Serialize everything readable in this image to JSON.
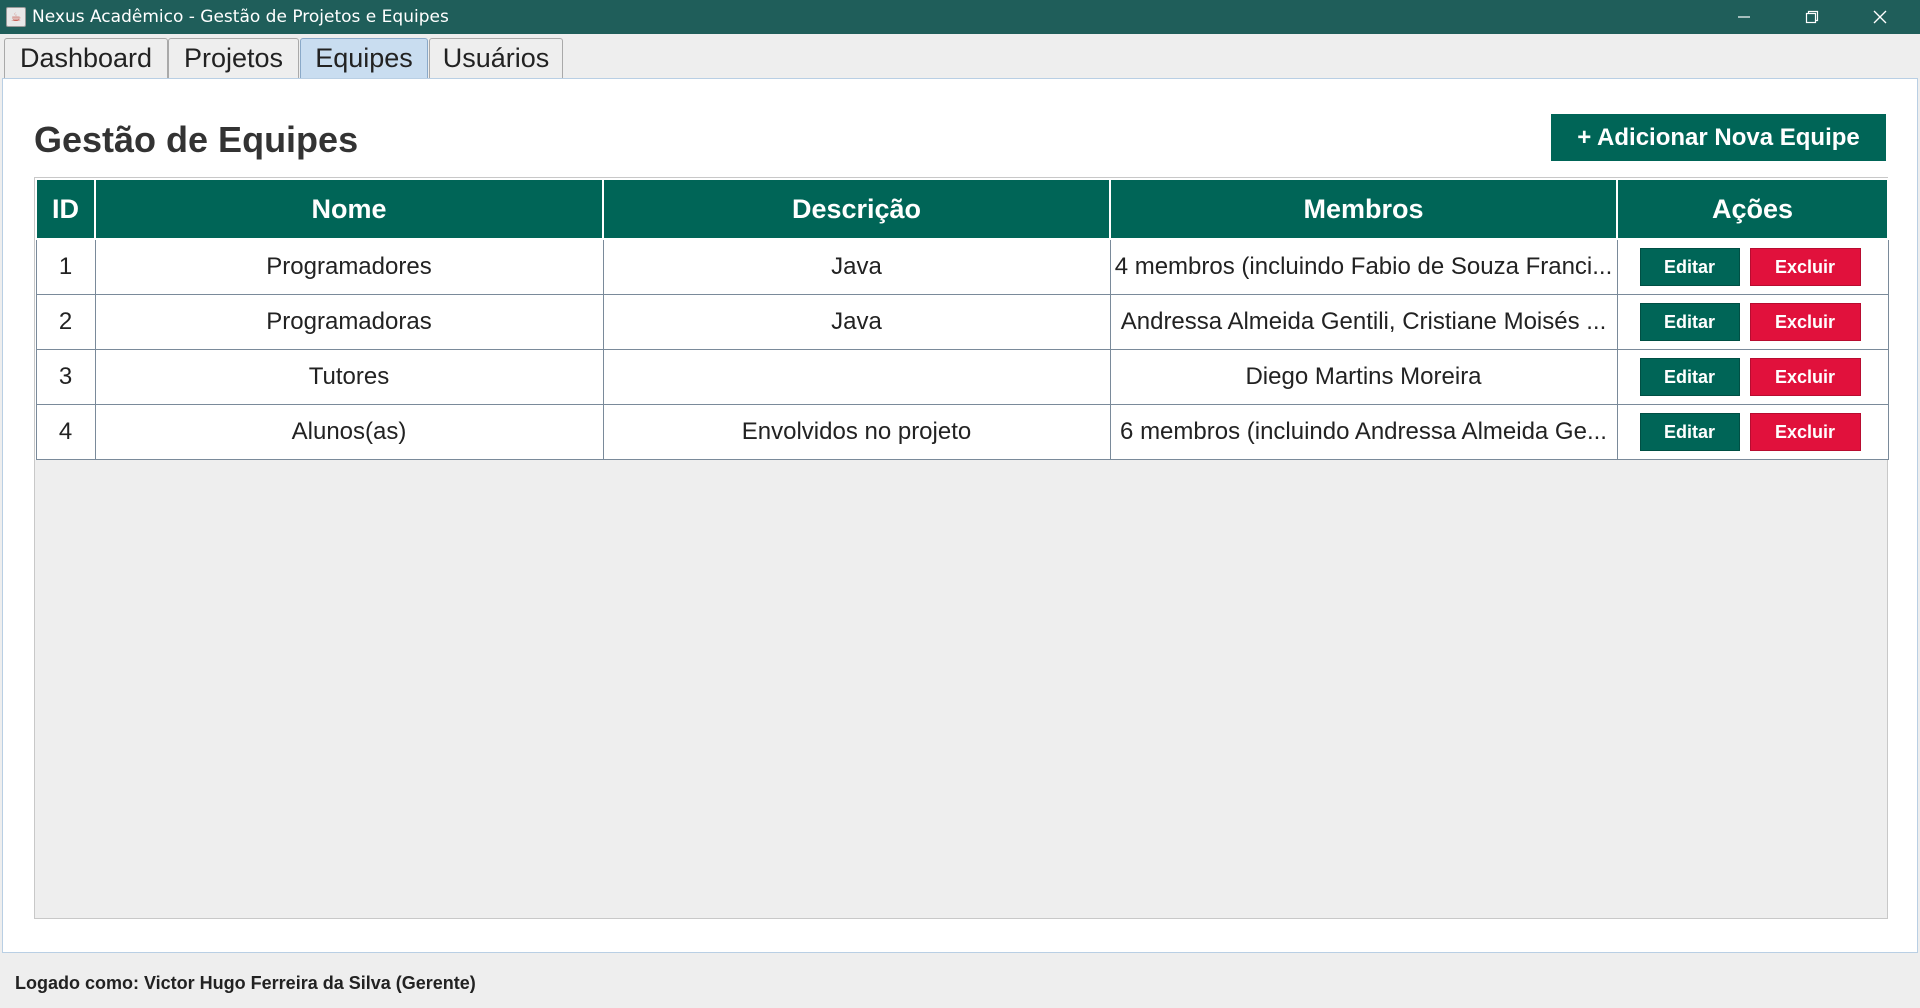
{
  "window": {
    "title": "Nexus Acadêmico - Gestão de Projetos e Equipes"
  },
  "tabs": [
    {
      "label": "Dashboard"
    },
    {
      "label": "Projetos"
    },
    {
      "label": "Equipes"
    },
    {
      "label": "Usuários"
    }
  ],
  "active_tab": "Equipes",
  "page": {
    "title": "Gestão de Equipes",
    "add_button_label": "+ Adicionar Nova Equipe"
  },
  "table": {
    "columns": [
      "ID",
      "Nome",
      "Descrição",
      "Membros",
      "Ações"
    ],
    "rows": [
      {
        "id": "1",
        "nome": "Programadores",
        "descricao": "Java",
        "membros": "4 membros (incluindo Fabio de Souza Franci..."
      },
      {
        "id": "2",
        "nome": "Programadoras",
        "descricao": "Java",
        "membros": "Andressa Almeida Gentili, Cristiane Moisés ..."
      },
      {
        "id": "3",
        "nome": "Tutores",
        "descricao": "",
        "membros": "Diego Martins Moreira"
      },
      {
        "id": "4",
        "nome": "Alunos(as)",
        "descricao": "Envolvidos no projeto",
        "membros": "6 membros (incluindo Andressa Almeida Ge..."
      }
    ],
    "edit_label": "Editar",
    "delete_label": "Excluir"
  },
  "statusbar": {
    "text": "Logado como: Victor Hugo Ferreira da Silva (Gerente)"
  },
  "colors": {
    "titlebar": "#1f5e5a",
    "primary": "#006557",
    "danger": "#e1113c",
    "active_tab": "#c9ddf0"
  }
}
